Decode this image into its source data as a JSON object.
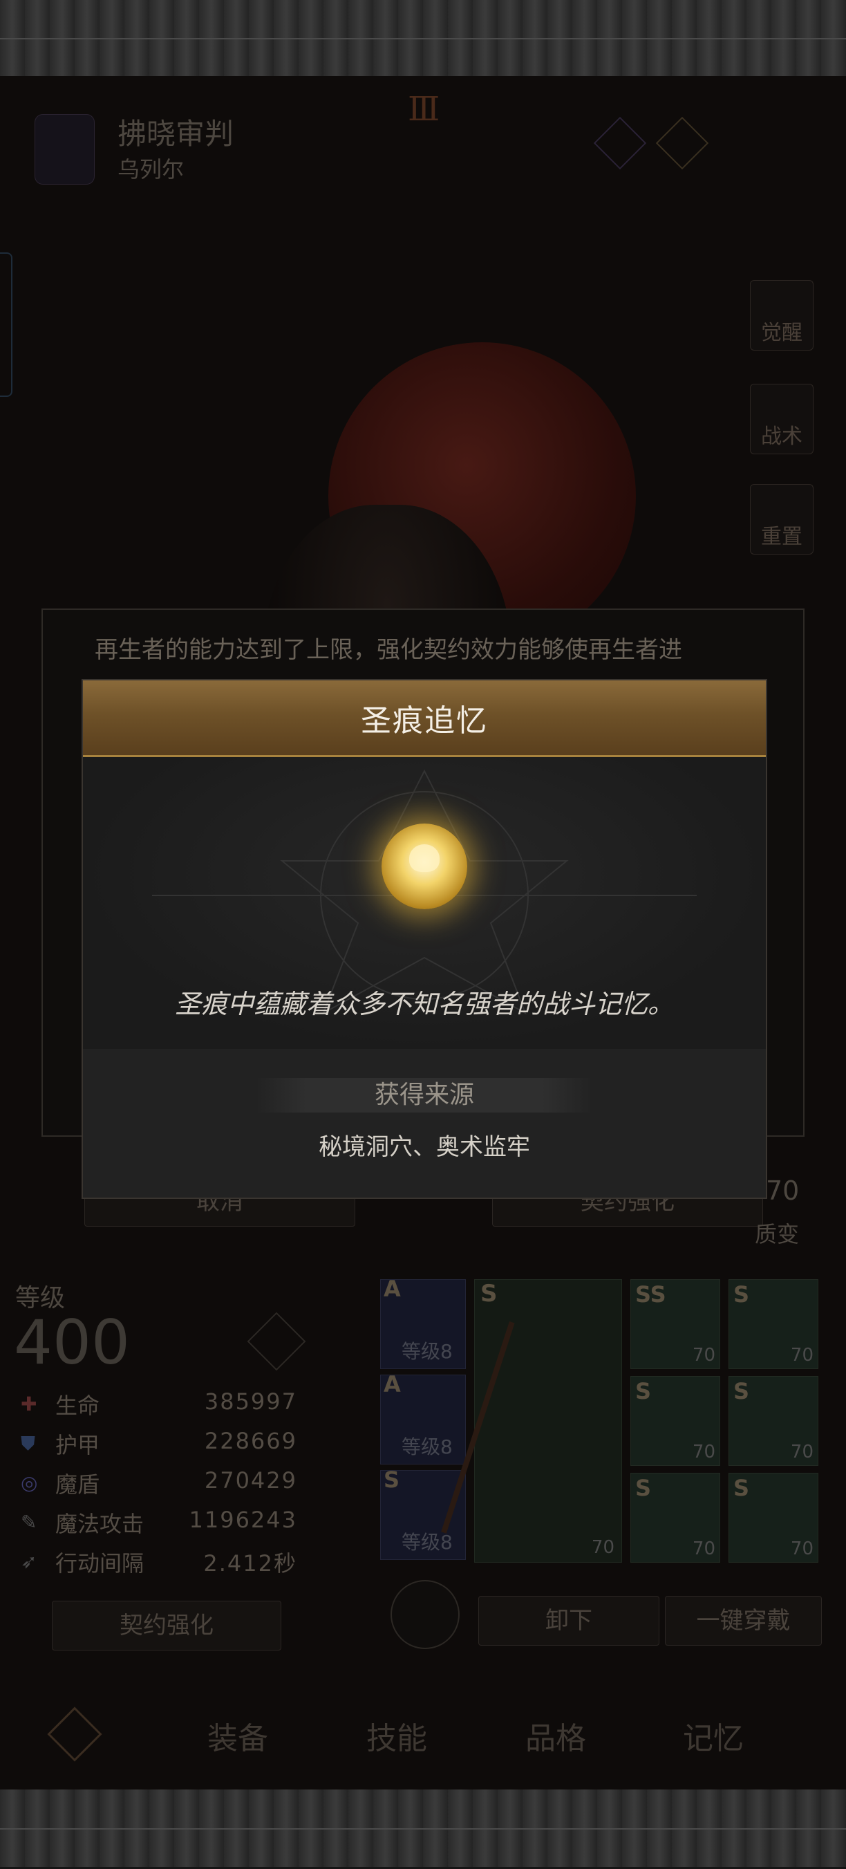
{
  "character": {
    "name": "拂晓审判",
    "subtitle": "乌列尔",
    "rank": "Ⅲ"
  },
  "side_menu": [
    {
      "label": "觉醒"
    },
    {
      "label": "战术"
    },
    {
      "label": "重置"
    }
  ],
  "behind_panel": {
    "text": "再生者的能力达到了上限，强化契约效力能够使再生者进",
    "cancel": "取消",
    "confirm": "契约强化",
    "level_badge": "70",
    "transmute": "质变"
  },
  "stats": {
    "level_label": "等级",
    "level": "400",
    "rows": [
      {
        "label": "生命",
        "value": "385997"
      },
      {
        "label": "护甲",
        "value": "228669"
      },
      {
        "label": "魔盾",
        "value": "270429"
      },
      {
        "label": "魔法攻击",
        "value": "1196243"
      },
      {
        "label": "行动间隔",
        "value": "2.412秒"
      }
    ]
  },
  "skills": [
    {
      "grade": "A",
      "level": "等级8"
    },
    {
      "grade": "A",
      "level": "等级8"
    },
    {
      "grade": "S",
      "level": "等级8"
    }
  ],
  "weapon": {
    "grade": "S",
    "level": "70"
  },
  "equipment": [
    {
      "grade": "SS",
      "level": "70"
    },
    {
      "grade": "S",
      "level": "70"
    },
    {
      "grade": "S",
      "level": "70"
    },
    {
      "grade": "S",
      "level": "70"
    },
    {
      "grade": "S",
      "level": "70"
    },
    {
      "grade": "S",
      "level": "70"
    }
  ],
  "actions": {
    "contract": "契约强化",
    "unequip": "卸下",
    "equip_all": "一键穿戴"
  },
  "bottom_nav": [
    {
      "label": "装备"
    },
    {
      "label": "技能"
    },
    {
      "label": "品格"
    },
    {
      "label": "记忆"
    }
  ],
  "modal": {
    "title": "圣痕追忆",
    "icon": "stigmata-orb-icon",
    "description": "圣痕中蕴藏着众多不知名强者的战斗记忆。",
    "source_label": "获得来源",
    "source_text": "秘境洞穴、奥术监牢"
  }
}
